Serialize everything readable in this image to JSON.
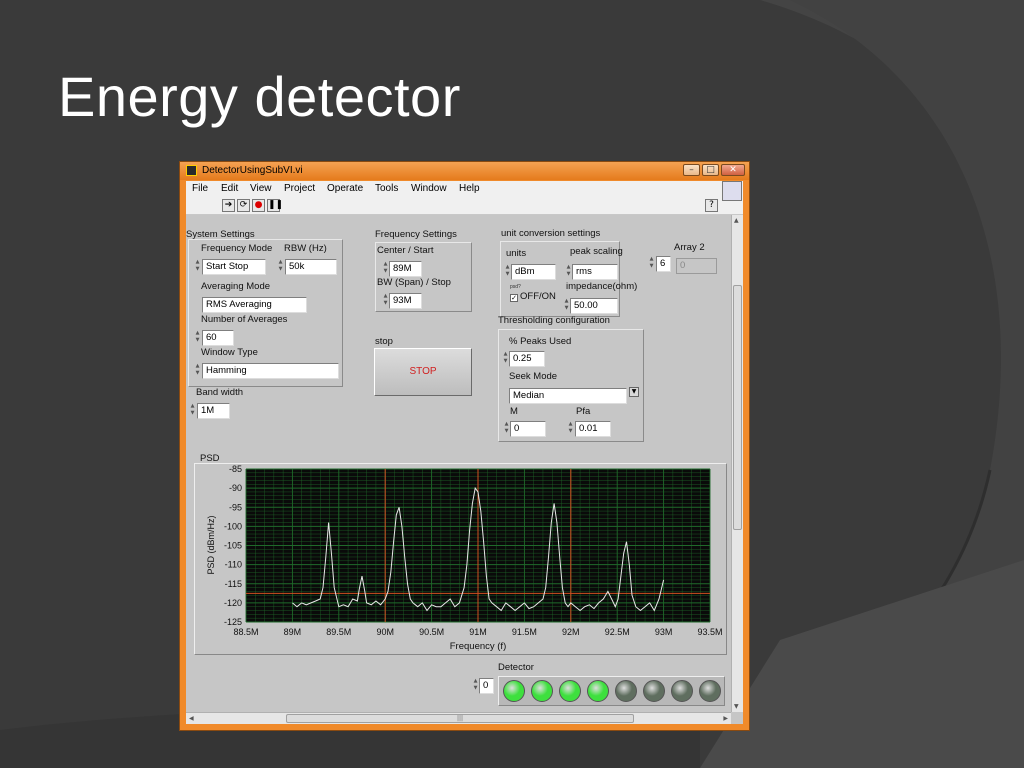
{
  "slide": {
    "title": "Energy detector"
  },
  "window": {
    "title": "DetectorUsingSubVI.vi",
    "controls": [
      "–",
      "□",
      "✕"
    ],
    "menu": [
      "File",
      "Edit",
      "View",
      "Project",
      "Operate",
      "Tools",
      "Window",
      "Help"
    ]
  },
  "system_settings": {
    "title": "System Settings",
    "frequency_mode_label": "Frequency Mode",
    "frequency_mode": "Start Stop",
    "rbw_label": "RBW (Hz)",
    "rbw": "50k",
    "averaging_mode_label": "Averaging Mode",
    "averaging_mode": "RMS Averaging",
    "num_averages_label": "Number of Averages",
    "num_averages": "60",
    "window_type_label": "Window Type",
    "window_type": "Hamming"
  },
  "bandwidth": {
    "label": "Band width",
    "value": "1M"
  },
  "frequency_settings": {
    "title": "Frequency Settings",
    "center_label": "Center / Start",
    "center": "89M",
    "span_label": "BW (Span) / Stop",
    "span": "93M"
  },
  "stop": {
    "label": "stop",
    "button": "STOP"
  },
  "unit_conversion": {
    "title": "unit conversion settings",
    "units_label": "units",
    "units": "dBm",
    "peak_scaling_label": "peak scaling",
    "peak_scaling": "rms",
    "psd_label": "psd?",
    "psd_toggle": "OFF/ON",
    "impedance_label": "impedance(ohm)",
    "impedance": "50.00"
  },
  "array2": {
    "label": "Array 2",
    "index": "6",
    "value": "0"
  },
  "thresholding": {
    "title": "Thresholding configuration",
    "peaks_used_label": "% Peaks Used",
    "peaks_used": "0.25",
    "seek_mode_label": "Seek Mode",
    "seek_mode": "Median",
    "m_label": "M",
    "m": "0",
    "pfa_label": "Pfa",
    "pfa": "0.01"
  },
  "detector": {
    "label": "Detector",
    "index": "0",
    "leds": [
      true,
      true,
      true,
      true,
      false,
      false,
      false,
      false
    ],
    "on_color": "#3ee03e",
    "off_color": "#5f6e5f"
  },
  "chart_data": {
    "type": "line",
    "title": "PSD",
    "xlabel": "Frequency (f)",
    "ylabel": "PSD (dBm/Hz)",
    "xlim": [
      88.5,
      93.5
    ],
    "ylim": [
      -125,
      -85
    ],
    "x_ticks": [
      "88.5M",
      "89M",
      "89.5M",
      "90M",
      "90.5M",
      "91M",
      "91.5M",
      "92M",
      "92.5M",
      "93M",
      "93.5M"
    ],
    "y_ticks": [
      "-85",
      "-90",
      "-95",
      "-100",
      "-105",
      "-110",
      "-115",
      "-120",
      "-125"
    ],
    "grid": true,
    "background": "#0a0a0a",
    "grid_color": "#1f6a2a",
    "cursor_color": "#d05020",
    "series_color": "#e8e8e8",
    "cursors_x": [
      90.0,
      91.0,
      92.0
    ],
    "cursor_y": -117.5,
    "series": [
      {
        "x": [
          89.0,
          89.05,
          89.1,
          89.15,
          89.2,
          89.25,
          89.3,
          89.33,
          89.36,
          89.39,
          89.42,
          89.45,
          89.5,
          89.55,
          89.6,
          89.65,
          89.7,
          89.72,
          89.75,
          89.78,
          89.8,
          89.85,
          89.9,
          89.95,
          90.0,
          90.03,
          90.06,
          90.09,
          90.12,
          90.15,
          90.18,
          90.21,
          90.24,
          90.27,
          90.3,
          90.35,
          90.4,
          90.45,
          90.5,
          90.55,
          90.6,
          90.65,
          90.7,
          90.75,
          90.8,
          90.85,
          90.88,
          90.91,
          90.94,
          90.97,
          91.0,
          91.03,
          91.06,
          91.09,
          91.12,
          91.15,
          91.2,
          91.25,
          91.3,
          91.35,
          91.4,
          91.45,
          91.5,
          91.55,
          91.6,
          91.65,
          91.7,
          91.73,
          91.76,
          91.79,
          91.82,
          91.85,
          91.88,
          91.91,
          91.94,
          91.97,
          92.0,
          92.05,
          92.1,
          92.15,
          92.2,
          92.25,
          92.3,
          92.35,
          92.4,
          92.45,
          92.48,
          92.51,
          92.54,
          92.57,
          92.6,
          92.63,
          92.66,
          92.7,
          92.75,
          92.8,
          92.85,
          92.9,
          92.95,
          93.0
        ],
        "y": [
          -120,
          -121,
          -120,
          -120.5,
          -120,
          -119.5,
          -119,
          -116,
          -108,
          -99,
          -107,
          -116,
          -121,
          -120.5,
          -121,
          -119,
          -119.5,
          -116.5,
          -113,
          -117,
          -120,
          -120.5,
          -119.5,
          -120.5,
          -119,
          -117,
          -112,
          -104,
          -97,
          -95,
          -100,
          -108,
          -115,
          -119,
          -120,
          -121,
          -120,
          -122,
          -120.5,
          -121,
          -121,
          -120,
          -119,
          -121,
          -120,
          -116,
          -110,
          -101,
          -94,
          -90,
          -91,
          -96,
          -104,
          -113,
          -119,
          -120,
          -121,
          -122,
          -120,
          -121,
          -122,
          -121,
          -120,
          -121.5,
          -121,
          -120,
          -119,
          -116,
          -108,
          -99,
          -94,
          -99,
          -108,
          -116,
          -120,
          -121,
          -120,
          -121,
          -122,
          -121,
          -120.5,
          -121.5,
          -120,
          -119,
          -117,
          -119.5,
          -121,
          -119,
          -113,
          -107,
          -104,
          -110,
          -118,
          -121,
          -122,
          -121,
          -120,
          -122,
          -119,
          -114
        ]
      }
    ]
  }
}
